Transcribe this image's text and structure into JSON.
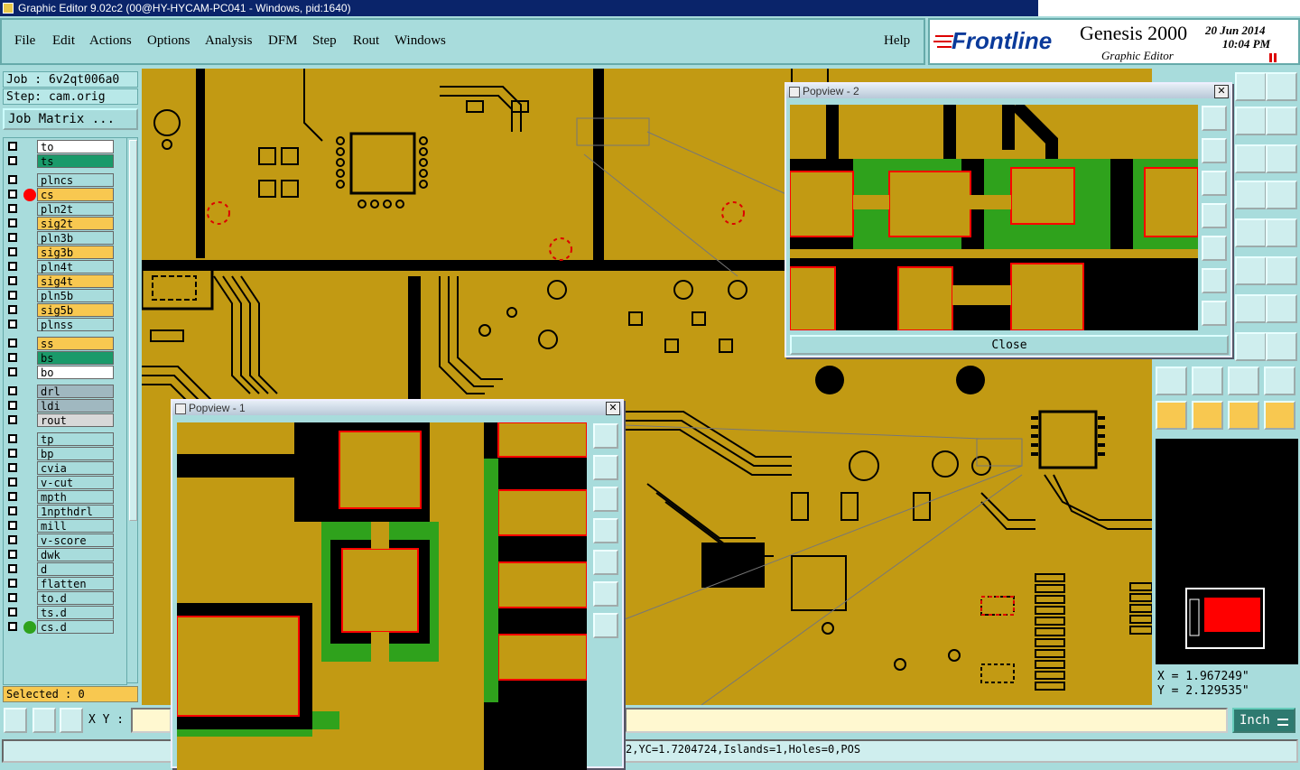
{
  "window": {
    "title": "Graphic Editor 9.02c2 (00@HY-HYCAM-PC041 - Windows, pid:1640)"
  },
  "menu": [
    {
      "label": "File"
    },
    {
      "label": "Edit"
    },
    {
      "label": "Actions"
    },
    {
      "label": "Options"
    },
    {
      "label": "Analysis"
    },
    {
      "label": "DFM"
    },
    {
      "label": "Step"
    },
    {
      "label": "Rout"
    },
    {
      "label": "Windows"
    }
  ],
  "help_label": "Help",
  "brand": {
    "logo": "Frontline",
    "product": "Genesis 2000",
    "subtitle": "Graphic Editor",
    "date": "20 Jun 2014",
    "time": "10:04 PM"
  },
  "job": {
    "job_label": "Job : 6v2qt006a0",
    "step_label": "Step: cam.orig",
    "matrix_button": "Job Matrix ..."
  },
  "colors": {
    "board": "#c29a13",
    "copper_gap": "#000000",
    "highlight": "#ff0000",
    "green": "#2fa21c",
    "panel": "#a8dcdc"
  },
  "layers": [
    {
      "name": "to",
      "bg": "#ffffff"
    },
    {
      "name": "ts",
      "bg": "#1a9a6a"
    },
    {
      "name": "plncs",
      "bg": "#a8dcdc"
    },
    {
      "name": "cs",
      "bg": "#f8c850",
      "marker": "#ff0000"
    },
    {
      "name": "pln2t",
      "bg": "#a8dcdc"
    },
    {
      "name": "sig2t",
      "bg": "#f8c850"
    },
    {
      "name": "pln3b",
      "bg": "#a8dcdc"
    },
    {
      "name": "sig3b",
      "bg": "#f8c850"
    },
    {
      "name": "pln4t",
      "bg": "#a8dcdc"
    },
    {
      "name": "sig4t",
      "bg": "#f8c850"
    },
    {
      "name": "pln5b",
      "bg": "#a8dcdc"
    },
    {
      "name": "sig5b",
      "bg": "#f8c850"
    },
    {
      "name": "plnss",
      "bg": "#a8dcdc"
    },
    {
      "name": "ss",
      "bg": "#f8c850"
    },
    {
      "name": "bs",
      "bg": "#1a9a6a"
    },
    {
      "name": "bo",
      "bg": "#ffffff"
    },
    {
      "name": "drl",
      "bg": "#a0b8c0"
    },
    {
      "name": "ldi",
      "bg": "#a0b8c0"
    },
    {
      "name": "rout",
      "bg": "#d8d8d8"
    },
    {
      "name": "tp",
      "bg": "#a8dcdc"
    },
    {
      "name": "bp",
      "bg": "#a8dcdc"
    },
    {
      "name": "cvia",
      "bg": "#a8dcdc"
    },
    {
      "name": "v-cut",
      "bg": "#a8dcdc"
    },
    {
      "name": "mpth",
      "bg": "#a8dcdc"
    },
    {
      "name": "1npthdrl",
      "bg": "#a8dcdc"
    },
    {
      "name": "mill",
      "bg": "#a8dcdc"
    },
    {
      "name": "v-score",
      "bg": "#a8dcdc"
    },
    {
      "name": "dwk",
      "bg": "#a8dcdc"
    },
    {
      "name": "d",
      "bg": "#a8dcdc"
    },
    {
      "name": "flatten",
      "bg": "#a8dcdc"
    },
    {
      "name": "to.d",
      "bg": "#a8dcdc"
    },
    {
      "name": "ts.d",
      "bg": "#a8dcdc"
    },
    {
      "name": "cs.d",
      "bg": "#a8dcdc",
      "marker": "#2fa21c"
    }
  ],
  "selected_label": "Selected : 0",
  "popview1": {
    "title": "Popview - 1"
  },
  "popview2": {
    "title": "Popview - 2",
    "close": "Close"
  },
  "coords": {
    "x": "X = 1.967249\"",
    "y": "Y = 2.129535\""
  },
  "xy_label": "X Y :",
  "units": "Inch",
  "status_text": "2,YC=1.7204724,Islands=1,Holes=0,POS"
}
